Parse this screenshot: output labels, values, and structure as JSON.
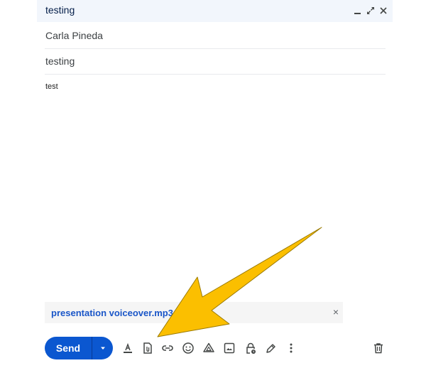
{
  "compose": {
    "window_title": "testing",
    "window_controls": {
      "minimize_icon": "minimize-icon",
      "expand_icon": "expand-icon",
      "close_icon": "close-icon"
    },
    "recipients": "Carla Pineda",
    "subject": "testing",
    "body": "test",
    "attachment": {
      "name": "presentation voiceover.mp3",
      "remove_glyph": "×"
    },
    "toolbar": {
      "send_label": "Send",
      "icons": [
        "formatting-icon",
        "attach-file-icon",
        "insert-link-icon",
        "emoji-icon",
        "drive-icon",
        "insert-photo-icon",
        "confidential-mode-icon",
        "signature-icon",
        "more-options-icon"
      ],
      "discard_icon": "trash-icon"
    }
  },
  "annotation": {
    "type": "arrow",
    "color": "#fbbf00",
    "points_to": "attach-file-icon"
  },
  "colors": {
    "header_bg": "#f2f6fc",
    "send_bg": "#0b57d0",
    "attachment_text": "#1a56c8"
  }
}
